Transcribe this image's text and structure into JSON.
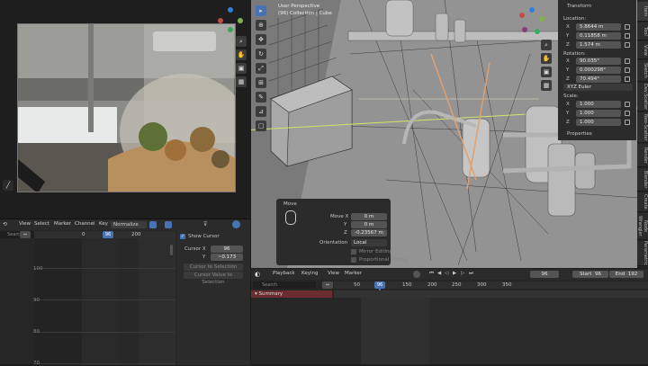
{
  "nla": {
    "icons": [
      "hand-icon",
      "camera-icon",
      "grid-icon",
      "eye-icon"
    ],
    "menu": {
      "view": "View",
      "select": "Select",
      "marker": "Marker",
      "channel": "Channel",
      "key": "Key",
      "normalize": "Normalize"
    },
    "search_placeholder": "Search",
    "ruler": [
      "0",
      "200"
    ],
    "current_frame": "96",
    "y_labels": [
      "100",
      "90",
      "80",
      "70"
    ],
    "cursor_panel": {
      "show_cursor": "Show Cursor",
      "cursor_x_label": "Cursor X",
      "cursor_x_value": "96",
      "y_label": "Y",
      "y_value": "~0.173",
      "btn1": "Cursor to Selection",
      "btn2": "Cursor Value to Selection"
    }
  },
  "viewport": {
    "overlay_title": "User Perspective",
    "overlay_sub": "(96) Collection | Cube",
    "right_tools": [
      "zoom-icon",
      "hand-icon",
      "camera-icon",
      "grid-icon"
    ],
    "tools": [
      "select-cursor-icon",
      "cursor-icon",
      "move-icon",
      "rotate-icon",
      "scale-icon",
      "transform-icon",
      "annotate-icon",
      "measure-icon",
      "add-cube-icon"
    ]
  },
  "transform": {
    "title": "Transform",
    "location_label": "Location:",
    "location": [
      {
        "axis": "X",
        "value": "5.8644 m"
      },
      {
        "axis": "Y",
        "value": "0.11858 m"
      },
      {
        "axis": "Z",
        "value": "1.574 m"
      }
    ],
    "rotation_label": "Rotation:",
    "rotation": [
      {
        "axis": "X",
        "value": "90.035°"
      },
      {
        "axis": "Y",
        "value": "0.000298°"
      },
      {
        "axis": "Z",
        "value": "70.494°"
      }
    ],
    "rotation_mode": "XYZ Euler",
    "scale_label": "Scale:",
    "scale": [
      {
        "axis": "X",
        "value": "1.000"
      },
      {
        "axis": "Y",
        "value": "1.000"
      },
      {
        "axis": "Z",
        "value": "1.000"
      }
    ],
    "properties": "Properties"
  },
  "side_tabs": [
    "Item",
    "Tool",
    "View",
    "Sketch",
    "Dev.Scatter",
    "Neo-Scatter",
    "Render",
    "Blender",
    "Create",
    "Node Wrangler",
    "Parametric"
  ],
  "move_panel": {
    "title": "Move",
    "move_x_label": "Move X",
    "move_x": "0 m",
    "y_label": "Y",
    "y": "0 m",
    "z_label": "Z",
    "z": "-0.23567 m",
    "orientation_label": "Orientation",
    "orientation": "Local",
    "proportional_editing": "Proportional Editing",
    "mirror_editing": "Mirror Editing"
  },
  "timeline": {
    "menu": {
      "playback": "Playback",
      "keying": "Keying",
      "view": "View",
      "marker": "Marker"
    },
    "current_frame": "96",
    "start_label": "Start",
    "start": "96",
    "end_label": "End",
    "end": "192",
    "search_placeholder": "Search",
    "summary": "Summary",
    "ruler": [
      "50",
      "96",
      "150",
      "200",
      "250",
      "300",
      "350"
    ]
  },
  "colors": {
    "accent": "#4772b3",
    "summary": "#6b2d2d"
  }
}
